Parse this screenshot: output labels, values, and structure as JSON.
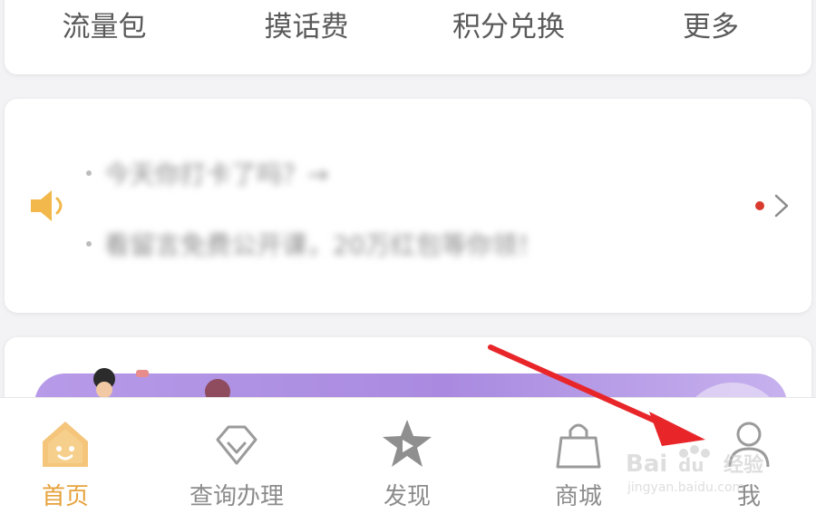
{
  "quick_actions": [
    {
      "label": "流量包"
    },
    {
      "label": "摸话费"
    },
    {
      "label": "积分兑换"
    },
    {
      "label": "更多"
    }
  ],
  "notice": {
    "icon": "speaker-icon",
    "lines": [
      "今天你打卡了吗？→",
      "看留言免费公开课，20万红包等你领！"
    ],
    "unread_color": "#d93a2e"
  },
  "tabbar": {
    "active_color": "#e6a23c",
    "tabs": [
      {
        "label": "首页",
        "icon": "home-icon"
      },
      {
        "label": "查询办理",
        "icon": "diamond-icon"
      },
      {
        "label": "发现",
        "icon": "star-play-icon"
      },
      {
        "label": "商城",
        "icon": "shopping-bag-icon"
      },
      {
        "label": "我",
        "icon": "user-icon"
      }
    ]
  },
  "watermark": {
    "brand": "Bai du 经验",
    "url": "jingyan.baidu.com"
  }
}
